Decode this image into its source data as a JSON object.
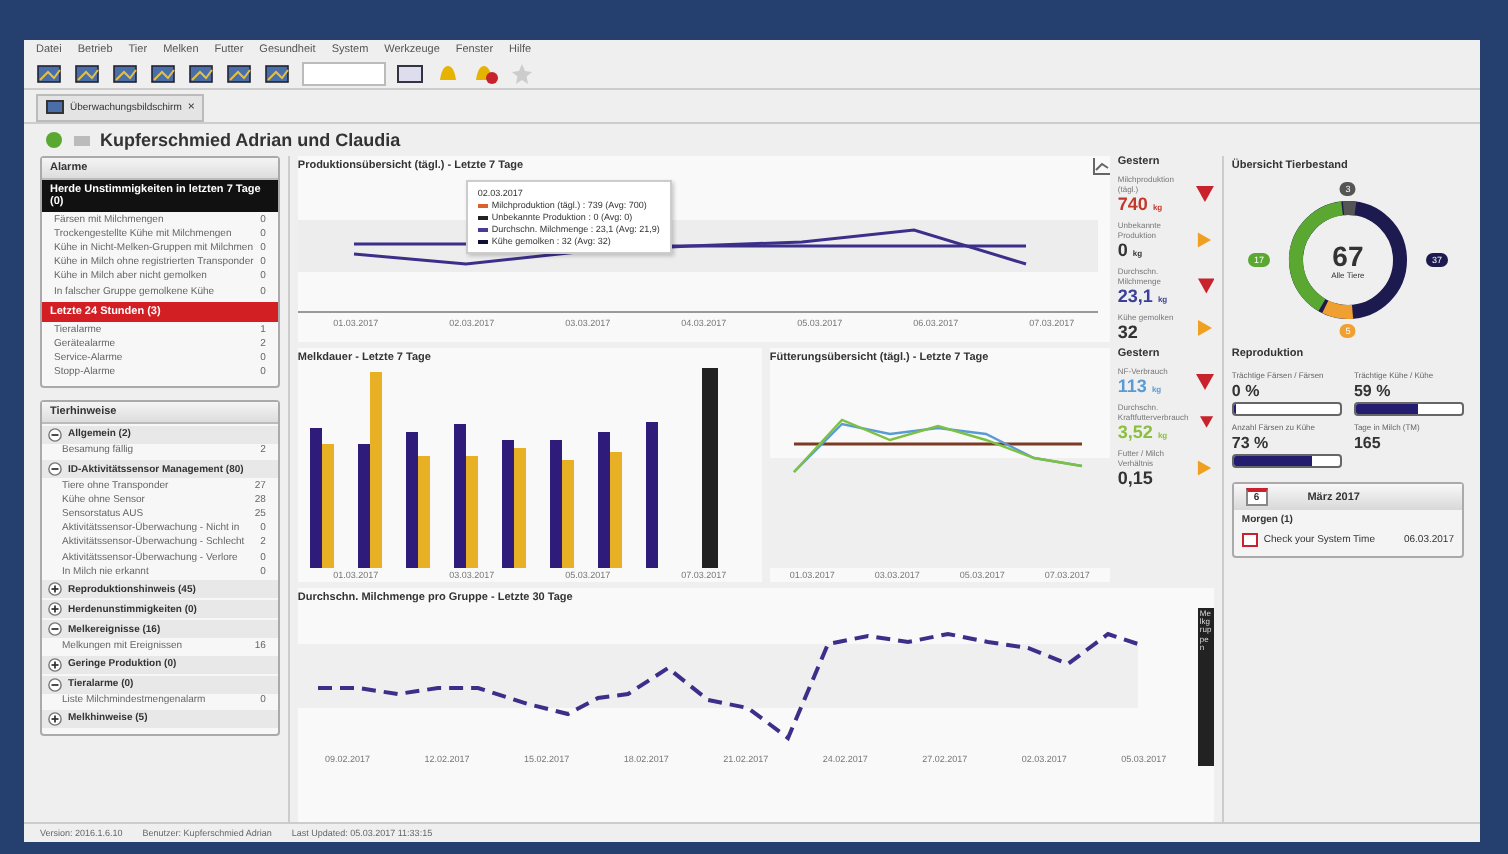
{
  "menu": [
    "Datei",
    "Betrieb",
    "Tier",
    "Melken",
    "Futter",
    "Gesundheit",
    "System",
    "Werkzeuge",
    "Fenster",
    "Hilfe"
  ],
  "tab": {
    "label": "Überwachungsbildschirm",
    "close": "×"
  },
  "title": "Kupferschmied Adrian und Claudia",
  "alarms": {
    "title": "Alarme",
    "groups": [
      {
        "kind": "info",
        "label": "Herde Unstimmigkeiten in letzten 7 Tage (0)",
        "items": [
          {
            "label": "Färsen mit Milchmengen",
            "count": "0"
          },
          {
            "label": "Trockengestellte Kühe mit Milchmengen",
            "count": "0"
          },
          {
            "label": "Kühe in Nicht-Melken-Gruppen mit Milchmen",
            "count": "0"
          },
          {
            "label": "Kühe in Milch ohne registrierten Transponder",
            "count": "0"
          },
          {
            "label": "Kühe in Milch aber nicht gemolken",
            "count": "0"
          },
          {
            "label": "In falscher Gruppe gemolkene Kühe",
            "count": "0"
          }
        ]
      },
      {
        "kind": "alert",
        "label": "Letzte 24 Stunden (3)",
        "items": [
          {
            "label": "Tieralarme",
            "count": "1"
          },
          {
            "label": "Gerätealarme",
            "count": "2"
          },
          {
            "label": "Service-Alarme",
            "count": "0"
          },
          {
            "label": "Stopp-Alarme",
            "count": "0"
          }
        ]
      }
    ]
  },
  "notes": {
    "title": "Tierhinweise",
    "groups": [
      {
        "label": "Allgemein (2)",
        "expanded": true,
        "items": [
          {
            "label": "Besamung fällig",
            "count": "2"
          }
        ]
      },
      {
        "label": "ID-Aktivitätssensor Management (80)",
        "expanded": true,
        "items": [
          {
            "label": "Tiere ohne Transponder",
            "count": "27"
          },
          {
            "label": "Kühe ohne Sensor",
            "count": "28"
          },
          {
            "label": "Sensorstatus AUS",
            "count": "25"
          },
          {
            "label": "Aktivitätssensor-Überwachung - Nicht in",
            "count": "0"
          },
          {
            "label": "Aktivitätssensor-Überwachung - Schlecht",
            "count": "2"
          },
          {
            "label": "Aktivitätssensor-Überwachung - Verlore",
            "count": "0"
          },
          {
            "label": "In Milch nie erkannt",
            "count": "0"
          }
        ]
      },
      {
        "label": "Reproduktionshinweis (45)",
        "expanded": false
      },
      {
        "label": "Herdenunstimmigkeiten (0)",
        "expanded": false
      },
      {
        "label": "Melkereignisse (16)",
        "expanded": true,
        "items": [
          {
            "label": "Melkungen mit Ereignissen",
            "count": "16"
          }
        ]
      },
      {
        "label": "Geringe Produktion (0)",
        "expanded": false
      },
      {
        "label": "Tieralarme (0)",
        "expanded": true,
        "items": [
          {
            "label": "Liste Milchmindestmengenalarm",
            "count": "0"
          }
        ]
      },
      {
        "label": "Melkhinweise (5)",
        "expanded": false
      }
    ]
  },
  "production": {
    "title": "Produktionsübersicht (tägl.) - Letzte 7 Tage",
    "x_labels": [
      "01.03.2017",
      "02.03.2017",
      "03.03.2017",
      "04.03.2017",
      "05.03.2017",
      "06.03.2017",
      "07.03.2017"
    ],
    "tooltip": {
      "date": "02.03.2017",
      "lines": [
        {
          "text": "Milchproduktion (tägl.) : 739  (Avg: 700)",
          "color": "#d9622b"
        },
        {
          "text": "Unbekannte Produktion : 0  (Avg: 0)",
          "color": "#222222"
        },
        {
          "text": "Durchschn. Milchmenge : 23,1  (Avg: 21,9)",
          "color": "#4a3a9a"
        },
        {
          "text": "Kühe gemolken : 32  (Avg: 32)",
          "color": "#111133"
        }
      ]
    }
  },
  "yesterday_production": {
    "title": "Gestern",
    "items": [
      {
        "label": "Milchproduktion (tägl.)",
        "value": "740",
        "unit": "kg",
        "color": "#c0392b",
        "kind": "down"
      },
      {
        "label": "Unbekannte Produktion",
        "value": "0",
        "unit": "kg",
        "color": "#333333",
        "kind": "flat"
      },
      {
        "label": "Durchschn. Milchmenge",
        "value": "23,1",
        "unit": "kg",
        "color": "#3b3f9a",
        "kind": "down"
      },
      {
        "label": "Kühe gemolken",
        "value": "32",
        "color": "#333333",
        "kind": "flat"
      }
    ]
  },
  "milking_time": {
    "title": "Melkdauer - Letzte 7 Tage",
    "x_labels": [
      "01.03.2017",
      "03.03.2017",
      "05.03.2017",
      "07.03.2017"
    ]
  },
  "feeding": {
    "title": "Fütterungsübersicht (tägl.) - Letzte 7 Tage",
    "x_labels": [
      "01.03.2017",
      "03.03.2017",
      "05.03.2017",
      "07.03.2017"
    ]
  },
  "yesterday_feeding": {
    "title": "Gestern",
    "items": [
      {
        "label": "NF-Verbrauch",
        "value": "113",
        "unit": "kg",
        "color": "#5b9bd5",
        "kind": "down"
      },
      {
        "label": "Durchschn. Kraftfutterverbrauch",
        "value": "3,52",
        "unit": "kg",
        "color": "#8cbf3f",
        "kind": "down"
      },
      {
        "label": "Futter / Milch Verhältnis",
        "value": "0,15",
        "color": "#333333",
        "kind": "flat"
      }
    ]
  },
  "group_milk": {
    "title": "Durchschn. Milchmenge pro Gruppe - Letzte 30 Tage",
    "x_labels": [
      "09.02.2017",
      "12.02.2017",
      "15.02.2017",
      "18.02.2017",
      "21.02.2017",
      "24.02.2017",
      "27.02.2017",
      "02.03.2017",
      "05.03.2017"
    ],
    "side_tab": "Melkgruppen"
  },
  "herd": {
    "title": "Übersicht Tierbestand",
    "total": "67",
    "total_label": "Alle Tiere",
    "badges": [
      {
        "text": "3",
        "color": "#555555"
      },
      {
        "text": "17",
        "color": "#5aa832"
      },
      {
        "text": "37",
        "color": "#1c1a4e"
      },
      {
        "text": "5",
        "color": "#f0a030"
      }
    ]
  },
  "reproduction": {
    "title": "Reproduktion",
    "items": [
      {
        "label": "Trächtige Färsen / Färsen",
        "value": "0 %",
        "level": 0
      },
      {
        "label": "Trächtige Kühe / Kühe",
        "value": "59 %",
        "level": 0.59
      },
      {
        "label": "Anzahl Färsen zu Kühe",
        "value": "73 %",
        "level": 0.73
      },
      {
        "label": "Tage in Milch (TM)",
        "value": "165"
      }
    ]
  },
  "calendar": {
    "day": "6",
    "month": "März 2017",
    "section": "Morgen (1)",
    "entries": [
      {
        "text": "Check your System Time",
        "date": "06.03.2017"
      }
    ]
  },
  "status_bar": [
    "Version: 2016.1.6.10",
    "Benutzer: Kupferschmied Adrian",
    "Last Updated: 05.03.2017 11:33:15"
  ]
}
